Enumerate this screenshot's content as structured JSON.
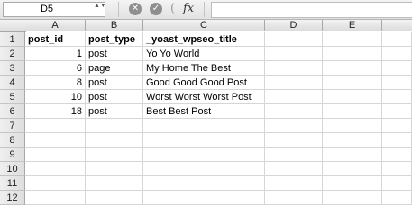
{
  "formula_bar": {
    "name_box": "D5",
    "name_box_arrows": "▲▼",
    "cancel_icon": "✕",
    "accept_icon": "✓",
    "paren_glyph": "(",
    "fx_label": "fx",
    "formula": ""
  },
  "columns": [
    "A",
    "B",
    "C",
    "D",
    "E"
  ],
  "rows": [
    "1",
    "2",
    "3",
    "4",
    "5",
    "6",
    "7",
    "8",
    "9",
    "10",
    "11",
    "12"
  ],
  "table": {
    "headers": [
      "post_id",
      "post_type",
      "_yoast_wpseo_title"
    ],
    "records": [
      {
        "post_id": "1",
        "post_type": "post",
        "title": "Yo Yo World"
      },
      {
        "post_id": "6",
        "post_type": "page",
        "title": "My Home The Best"
      },
      {
        "post_id": "8",
        "post_type": "post",
        "title": "Good Good Good Post"
      },
      {
        "post_id": "10",
        "post_type": "post",
        "title": "Worst Worst Worst Post"
      },
      {
        "post_id": "18",
        "post_type": "post",
        "title": "Best Best Post"
      }
    ]
  }
}
